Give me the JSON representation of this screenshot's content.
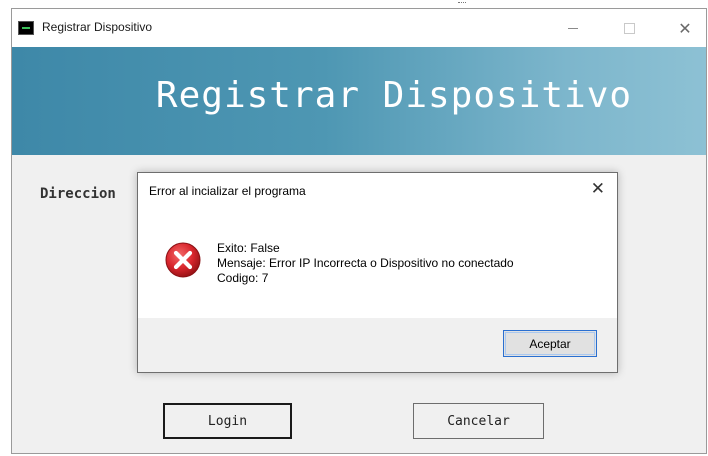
{
  "window": {
    "title": "Registrar Dispositivo",
    "icons": {
      "app": "terminal-icon",
      "minimize": "minimize-icon",
      "maximize": "maximize-icon",
      "close": "close-icon"
    }
  },
  "banner": {
    "title": "Registrar Dispositivo"
  },
  "form": {
    "direccion_label": "Direccion",
    "login_label": "Login",
    "cancel_label": "Cancelar"
  },
  "dialog": {
    "title": "Error al incializar el programa",
    "icon": "error-icon",
    "lines": [
      "Exito: False",
      "Mensaje: Error IP Incorrecta o Dispositivo no conectado",
      "Codigo: 7"
    ],
    "accept_label": "Aceptar"
  },
  "colors": {
    "banner_start": "#3e88a8",
    "banner_end": "#8dc1d4",
    "error_red": "#d9262d",
    "accent_blue": "#2a6fd0"
  }
}
